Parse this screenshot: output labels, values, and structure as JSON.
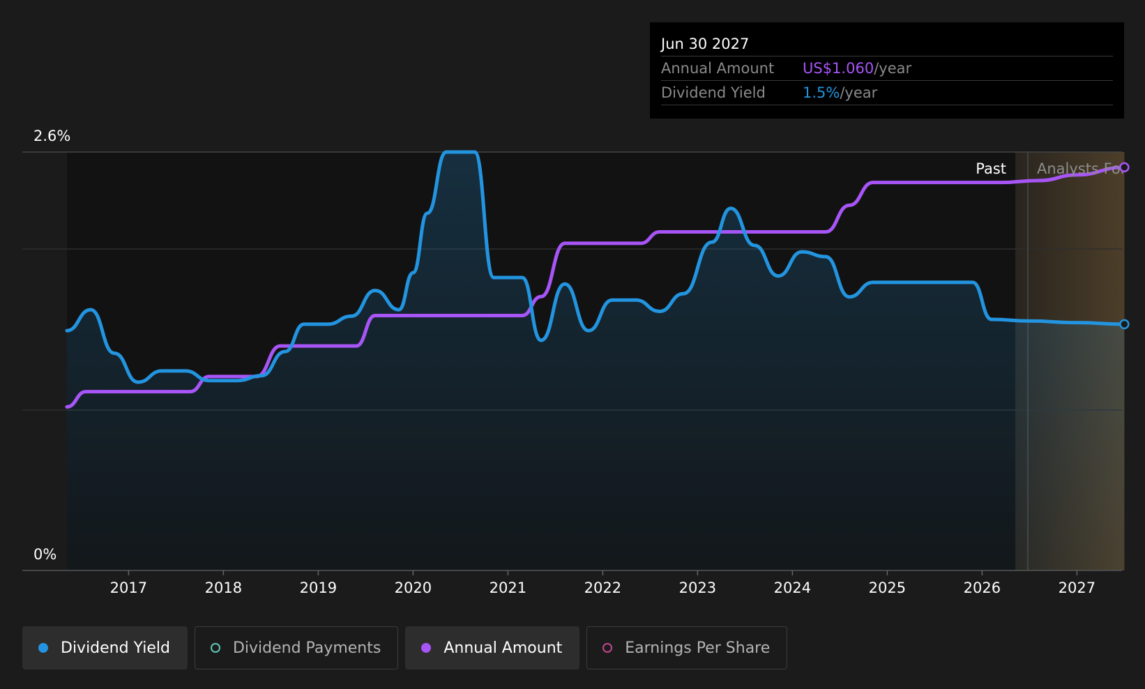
{
  "tooltip": {
    "date": "Jun 30 2027",
    "rows": [
      {
        "label": "Annual Amount",
        "value": "US$1.060",
        "unit": "/year",
        "color": "#a855f7"
      },
      {
        "label": "Dividend Yield",
        "value": "1.5%",
        "unit": "/year",
        "color": "#2394df"
      }
    ]
  },
  "legend": [
    {
      "label": "Dividend Yield",
      "color": "#2394df",
      "active": true,
      "icon": "filled-circle"
    },
    {
      "label": "Dividend Payments",
      "color": "#5ec8b8",
      "active": false,
      "icon": "hollow-circle"
    },
    {
      "label": "Annual Amount",
      "color": "#a855f7",
      "active": true,
      "icon": "filled-circle"
    },
    {
      "label": "Earnings Per Share",
      "color": "#c2478c",
      "active": false,
      "icon": "hollow-circle"
    }
  ],
  "chart_data": {
    "type": "line",
    "title": "",
    "y_tick_labels": [
      "2.6%",
      "0%"
    ],
    "ylim": [
      0,
      2.6
    ],
    "xlim": [
      2016.35,
      2027.5
    ],
    "x_ticks": [
      2017,
      2018,
      2019,
      2020,
      2021,
      2022,
      2023,
      2024,
      2025,
      2026,
      2027
    ],
    "grid": true,
    "regions": [
      {
        "label": "Past",
        "from": 2016.35,
        "to": 2026.35
      },
      {
        "label": "Analysts Forecasts",
        "from": 2026.35,
        "to": 2027.5
      }
    ],
    "series": [
      {
        "name": "Dividend Yield",
        "unit": "%",
        "color": "#2394df",
        "area": true,
        "x": [
          2016.35,
          2016.6,
          2016.85,
          2017.1,
          2017.35,
          2017.6,
          2017.85,
          2018.15,
          2018.4,
          2018.65,
          2018.85,
          2019.1,
          2019.35,
          2019.6,
          2019.85,
          2020.0,
          2020.15,
          2020.35,
          2020.65,
          2020.85,
          2021.15,
          2021.35,
          2021.6,
          2021.85,
          2022.1,
          2022.35,
          2022.6,
          2022.85,
          2023.15,
          2023.35,
          2023.6,
          2023.85,
          2024.1,
          2024.35,
          2024.6,
          2024.85,
          2025.1,
          2025.4,
          2025.9,
          2026.1,
          2026.5,
          2027.0,
          2027.5
        ],
        "y": [
          1.49,
          1.62,
          1.35,
          1.17,
          1.24,
          1.24,
          1.18,
          1.18,
          1.21,
          1.36,
          1.53,
          1.53,
          1.58,
          1.74,
          1.62,
          1.85,
          2.22,
          2.6,
          2.6,
          1.82,
          1.82,
          1.43,
          1.78,
          1.49,
          1.68,
          1.68,
          1.61,
          1.72,
          2.04,
          2.25,
          2.02,
          1.83,
          1.98,
          1.95,
          1.7,
          1.79,
          1.79,
          1.79,
          1.79,
          1.56,
          1.55,
          1.54,
          1.53
        ]
      },
      {
        "name": "Annual Amount",
        "unit": "US$/year",
        "color": "#a855f7",
        "area": false,
        "x": [
          2016.35,
          2016.55,
          2017.0,
          2017.65,
          2017.85,
          2018.35,
          2018.6,
          2019.4,
          2019.6,
          2021.15,
          2021.35,
          2021.6,
          2022.4,
          2022.6,
          2024.35,
          2024.6,
          2024.85,
          2026.2,
          2026.6,
          2027.0,
          2027.5
        ],
        "y": [
          0.43,
          0.47,
          0.47,
          0.47,
          0.51,
          0.51,
          0.59,
          0.59,
          0.67,
          0.67,
          0.72,
          0.86,
          0.86,
          0.89,
          0.89,
          0.96,
          1.02,
          1.02,
          1.025,
          1.04,
          1.06
        ],
        "y_axis_max_unlabeled": 1.1
      }
    ]
  }
}
